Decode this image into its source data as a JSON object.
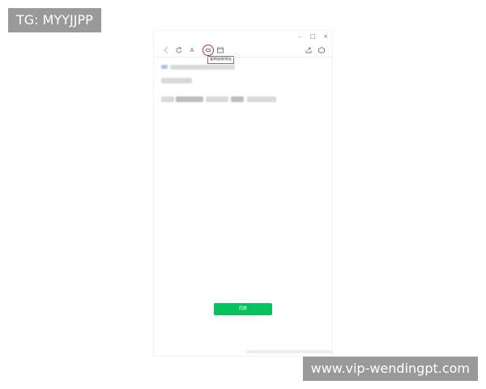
{
  "watermarks": {
    "top_left": "TG: MYYJJPP",
    "bottom_right": "www.vip-wendingpt.com"
  },
  "window": {
    "controls": [
      {
        "name": "minimize-icon",
        "glyph": "–"
      },
      {
        "name": "maximize-icon",
        "glyph": "□"
      },
      {
        "name": "close-icon",
        "glyph": "×"
      }
    ],
    "toolbar": {
      "font_button_label": "A",
      "tooltip": "复制链接地址"
    },
    "action_button_label": "同意"
  },
  "colors": {
    "accent_green": "#07c160",
    "highlight_ring": "#b33131",
    "watermark_bg": "#999999"
  }
}
